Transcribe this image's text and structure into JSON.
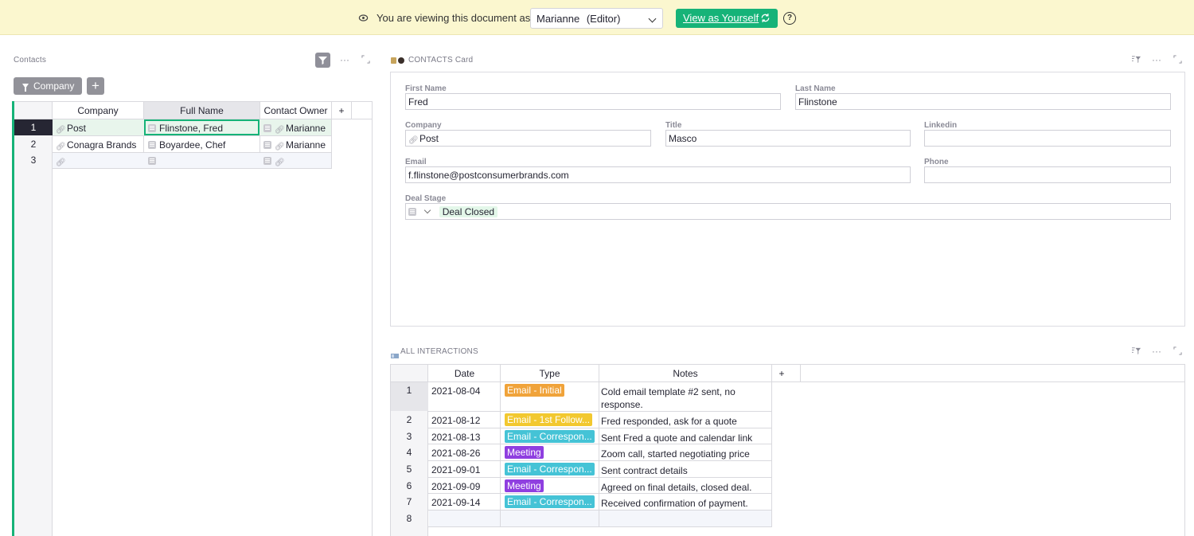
{
  "banner": {
    "message": "You are viewing this document as",
    "user": "Marianne",
    "role": "(Editor)",
    "view_button": "View as Yourself",
    "help": "?"
  },
  "contacts": {
    "title": "Contacts",
    "filter_chip": "Company",
    "add_chip": "+",
    "columns": [
      "Company",
      "Full Name",
      "Contact Owner",
      "+"
    ],
    "rows": [
      {
        "num": "1",
        "company": "Post",
        "full_name": "Flinstone, Fred",
        "owner": "Marianne"
      },
      {
        "num": "2",
        "company": "Conagra Brands",
        "full_name": "Boyardee, Chef",
        "owner": "Marianne"
      },
      {
        "num": "3",
        "company": "",
        "full_name": "",
        "owner": ""
      }
    ]
  },
  "card": {
    "title": "CONTACTS Card",
    "fields": {
      "first_name": {
        "label": "First Name",
        "value": "Fred"
      },
      "last_name": {
        "label": "Last Name",
        "value": "Flinstone"
      },
      "company": {
        "label": "Company",
        "value": "Post"
      },
      "title": {
        "label": "Title",
        "value": "Masco"
      },
      "linkedin": {
        "label": "Linkedin",
        "value": ""
      },
      "email": {
        "label": "Email",
        "value": "f.flinstone@postconsumerbrands.com"
      },
      "phone": {
        "label": "Phone",
        "value": ""
      },
      "deal_stage": {
        "label": "Deal Stage",
        "value": "Deal Closed"
      }
    }
  },
  "interactions": {
    "title": "ALL INTERACTIONS",
    "columns": [
      "Date",
      "Type",
      "Notes",
      "+"
    ],
    "rows": [
      {
        "num": "1",
        "date": "2021-08-04",
        "type": "Email - Initial",
        "color": "#f0a33a",
        "notes": "Cold email template #2 sent, no",
        "notes2": "response."
      },
      {
        "num": "2",
        "date": "2021-08-12",
        "type": "Email - 1st Follow...",
        "color": "#f2c82f",
        "notes": "Fred responded, ask for a quote",
        "notes2": ""
      },
      {
        "num": "3",
        "date": "2021-08-13",
        "type": "Email - Correspon...",
        "color": "#45c3d6",
        "notes": "Sent Fred a quote and calendar link",
        "notes2": ""
      },
      {
        "num": "4",
        "date": "2021-08-26",
        "type": "Meeting",
        "color": "#8f3fe0",
        "notes": "Zoom call, started negotiating price",
        "notes2": ""
      },
      {
        "num": "5",
        "date": "2021-09-01",
        "type": "Email - Correspon...",
        "color": "#45c3d6",
        "notes": "Sent contract details",
        "notes2": ""
      },
      {
        "num": "6",
        "date": "2021-09-09",
        "type": "Meeting",
        "color": "#8f3fe0",
        "notes": "Agreed on final details, closed deal.",
        "notes2": ""
      },
      {
        "num": "7",
        "date": "2021-09-14",
        "type": "Email - Correspon...",
        "color": "#45c3d6",
        "notes": "Received confirmation of payment.",
        "notes2": ""
      },
      {
        "num": "8",
        "date": "",
        "type": "",
        "color": "",
        "notes": "",
        "notes2": ""
      }
    ]
  },
  "icons": {
    "eye": "eye-icon",
    "refresh": "refresh-icon",
    "help": "help-icon",
    "filter": "filter-icon",
    "more": "more-icon",
    "expand": "expand-icon",
    "link": "link-icon",
    "reference": "reference-icon"
  }
}
